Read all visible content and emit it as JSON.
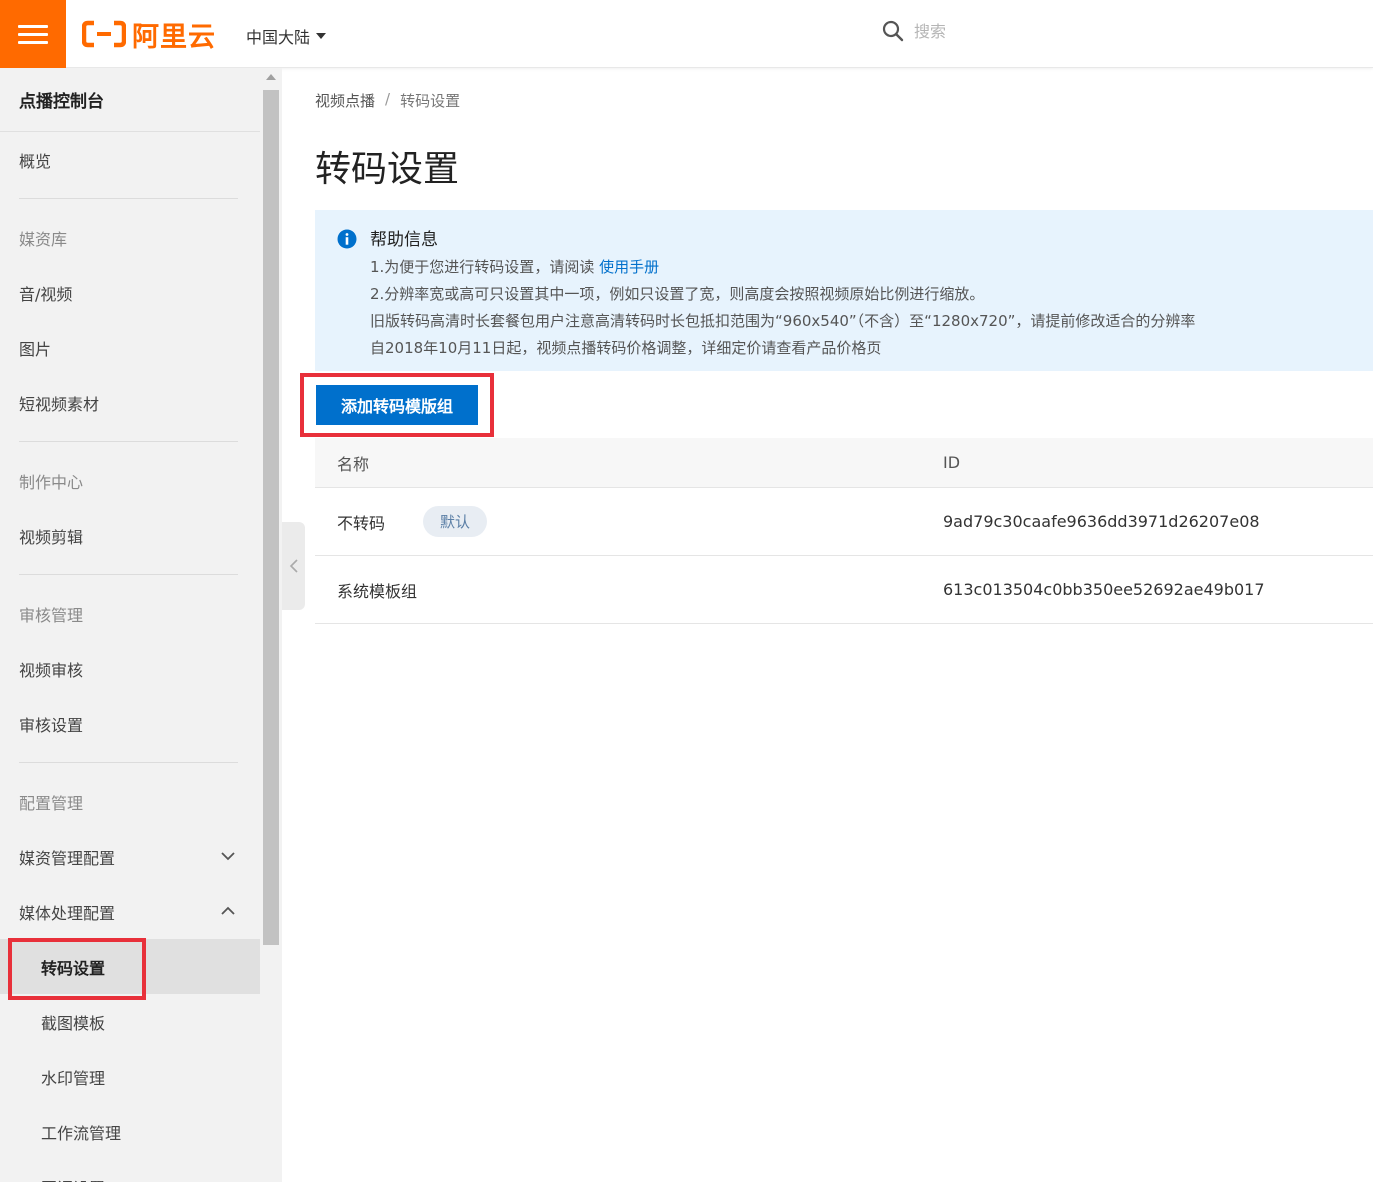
{
  "header": {
    "brand_text": "阿里云",
    "region": "中国大陆",
    "search_placeholder": "搜索"
  },
  "sidebar": {
    "title": "点播控制台",
    "overview": "概览",
    "media_group": "媒资库",
    "media_items": [
      "音/视频",
      "图片",
      "短视频素材"
    ],
    "production_group": "制作中心",
    "production_items": [
      "视频剪辑"
    ],
    "review_group": "审核管理",
    "review_items": [
      "视频审核",
      "审核设置"
    ],
    "config_group": "配置管理",
    "config_items": [
      "媒资管理配置",
      "媒体处理配置"
    ],
    "processing_subitems": [
      "转码设置",
      "截图模板",
      "水印管理",
      "工作流管理",
      "回调设置"
    ],
    "active_item": "转码设置"
  },
  "breadcrumb": {
    "root": "视频点播",
    "separator": "/",
    "current": "转码设置"
  },
  "page_title": "转码设置",
  "help": {
    "title": "帮助信息",
    "line1_prefix": "1.为便于您进行转码设置，请阅读",
    "line1_link": "使用手册",
    "line2": "2.分辨率宽或高可只设置其中一项，例如只设置了宽，则高度会按照视频原始比例进行缩放。",
    "line3": "旧版转码高清时长套餐包用户注意高清转码时长包抵扣范围为“960x540”（不含）至“1280x720”，请提前修改适合的分辨率",
    "line4": "自2018年10月11日起，视频点播转码价格调整，详细定价请查看产品价格页"
  },
  "add_button_label": "添加转码模版组",
  "table": {
    "columns": [
      "名称",
      "ID"
    ],
    "rows": [
      {
        "name": "不转码",
        "badge": "默认",
        "id": "9ad79c30caafe9636dd3971d26207e08"
      },
      {
        "name": "系统模板组",
        "badge": "",
        "id": "613c013504c0bb350ee52692ae49b017"
      }
    ]
  },
  "colors": {
    "brand_orange": "#ff6a00",
    "primary_blue": "#0070cc",
    "highlight_red": "#e8303a",
    "help_bg": "#e7f3fd"
  }
}
